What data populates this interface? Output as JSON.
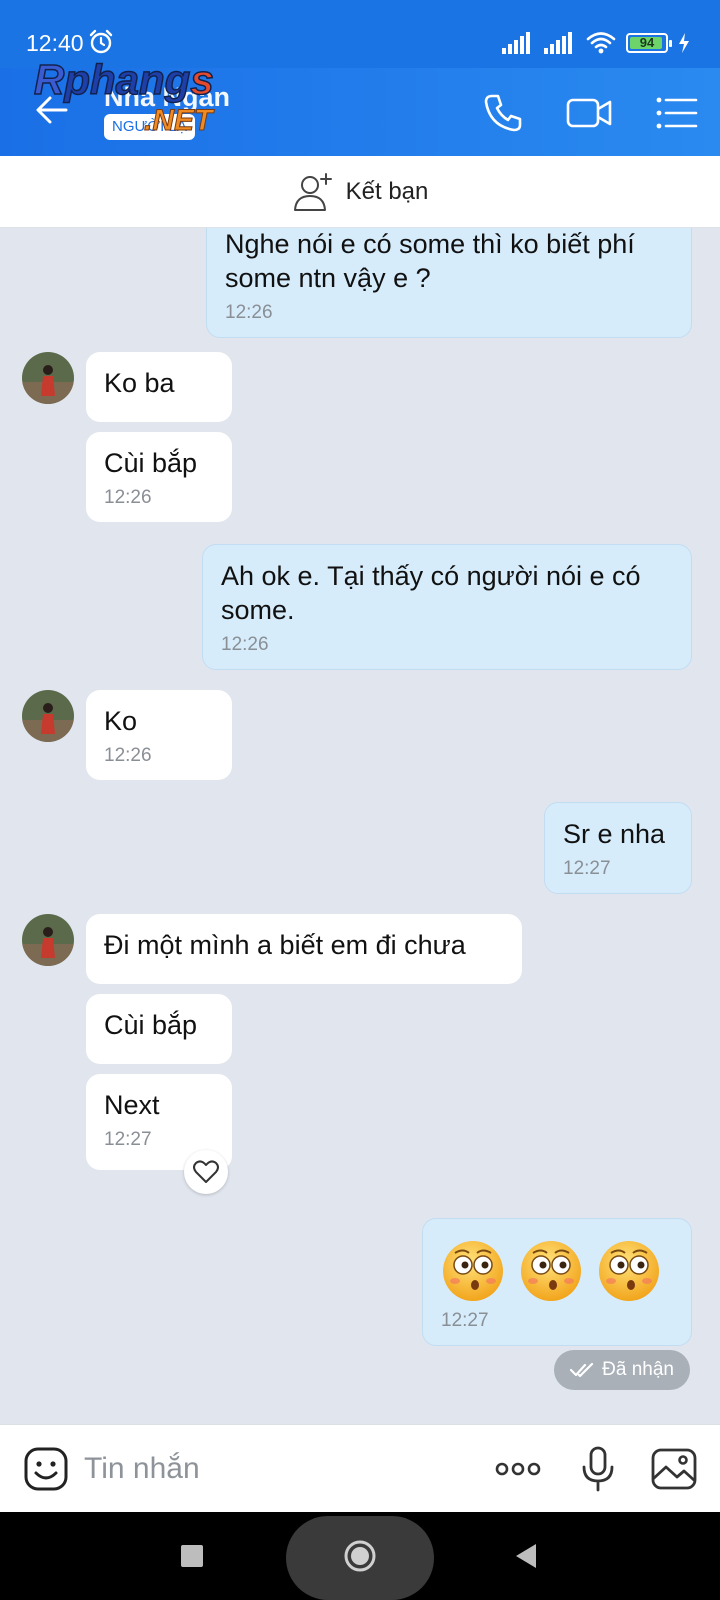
{
  "status_bar": {
    "time": "12:40",
    "battery": "94",
    "battery_level": 0.94
  },
  "header": {
    "contact_name": "Nha Ngan",
    "stranger_badge": "NGƯỜI LẠ",
    "watermark": "Rphangs NET"
  },
  "friend_bar": {
    "label": "Kết bạn"
  },
  "messages": [
    {
      "dir": "out",
      "text": "Nghe nói e có some thì ko biết phí some ntn vậy e ?",
      "time": "12:26"
    },
    {
      "dir": "in",
      "text": "Ko ba",
      "time": ""
    },
    {
      "dir": "in",
      "text": "Cùi bắp",
      "time": "12:26"
    },
    {
      "dir": "out",
      "text": "Ah ok e. Tại thấy có người nói e có some.",
      "time": "12:26"
    },
    {
      "dir": "in",
      "text": "Ko",
      "time": "12:26"
    },
    {
      "dir": "out",
      "text": "Sr e nha",
      "time": "12:27"
    },
    {
      "dir": "in",
      "text": "Đi một mình a biết em đi chưa",
      "time": ""
    },
    {
      "dir": "in",
      "text": "Cùi bắp",
      "time": ""
    },
    {
      "dir": "in",
      "text": "Next",
      "time": "12:27"
    },
    {
      "dir": "out",
      "text": "",
      "emoji": "flushed-face",
      "count": 3,
      "time": "12:27"
    }
  ],
  "received_status": "Đã nhận",
  "composer": {
    "placeholder": "Tin nhắn"
  },
  "colors": {
    "header": "#1a6fe6",
    "outgoing_bubble": "#d6ecfb",
    "incoming_bubble": "#ffffff",
    "chat_background": "#e1e6ee"
  },
  "icons": [
    "alarm-icon",
    "signal-icon",
    "wifi-icon",
    "battery-icon",
    "charging-icon",
    "back-arrow-icon",
    "phone-icon",
    "video-icon",
    "menu-icon",
    "add-friend-icon",
    "heart-icon",
    "double-check-icon",
    "sticker-icon",
    "more-icon",
    "microphone-icon",
    "image-icon",
    "recent-apps-icon",
    "home-icon",
    "back-triangle-icon"
  ]
}
